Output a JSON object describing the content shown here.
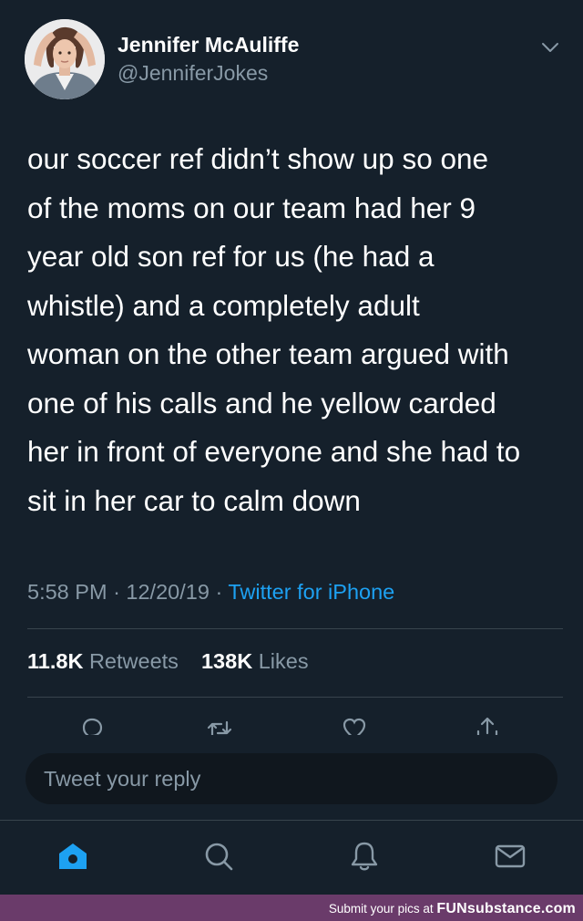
{
  "author": {
    "name": "Jennifer McAuliffe",
    "handle": "@JenniferJokes"
  },
  "tweet": {
    "text": "our soccer ref didn’t show up so one\nof the moms on our team had her 9\nyear old son ref for us (he had a\nwhistle) and a completely adult\nwoman on the other team argued with\none of his calls and he yellow carded\nher in front of everyone and she had to\nsit in her car to calm down",
    "time": "5:58 PM",
    "date": "12/20/19",
    "separator": "·",
    "source": "Twitter for iPhone"
  },
  "stats": {
    "retweets_count": "11.8K",
    "retweets_label": "Retweets",
    "likes_count": "138K",
    "likes_label": "Likes"
  },
  "reply": {
    "placeholder": "Tweet your reply"
  },
  "icons": {
    "more": "chevron-down-icon",
    "reply": "reply-icon",
    "retweet": "retweet-icon",
    "like": "heart-icon",
    "share": "share-icon",
    "home": "home-icon",
    "search": "search-icon",
    "notifications": "bell-icon",
    "messages": "mail-icon"
  },
  "colors": {
    "background": "#15202b",
    "accent": "#1da1f2",
    "secondary_text": "#8899a6",
    "divider": "#38444d",
    "watermark_bg": "#6a3b6a"
  },
  "watermark": {
    "prefix": "Submit your pics at",
    "brand": "FUNsubstance.com"
  }
}
